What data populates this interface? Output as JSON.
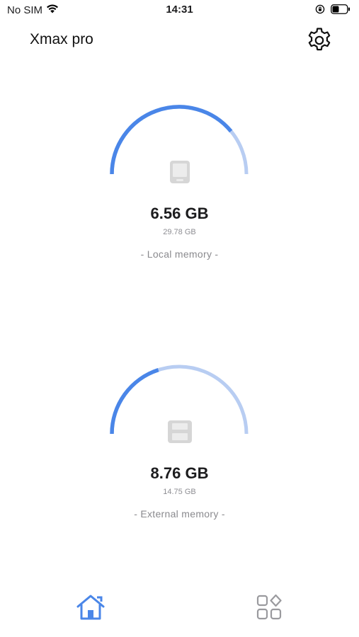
{
  "status_bar": {
    "carrier": "No SIM",
    "time": "14:31",
    "icons": [
      "wifi-icon",
      "orientation-lock-icon",
      "battery-icon"
    ],
    "battery_level": 0.45
  },
  "header": {
    "title": "Xmax pro",
    "settings_icon": "gear-icon"
  },
  "local_memory": {
    "used": "6.56 GB",
    "total": "29.78 GB",
    "label": "- Local memory -",
    "used_fraction": 0.78,
    "icon": "tablet-icon"
  },
  "external_memory": {
    "used": "8.76 GB",
    "total": "14.75 GB",
    "label": "- External memory -",
    "used_fraction": 0.4,
    "icon": "floppy-disk-icon"
  },
  "tabbar": {
    "tabs": [
      {
        "name": "home",
        "icon": "home-icon",
        "active": true
      },
      {
        "name": "apps",
        "icon": "apps-grid-icon",
        "active": false
      }
    ]
  },
  "colors": {
    "accent": "#4a86e8",
    "track": "#b8cdf2",
    "icon_gray": "#d6d6d6",
    "text_secondary": "#8e8e93"
  }
}
